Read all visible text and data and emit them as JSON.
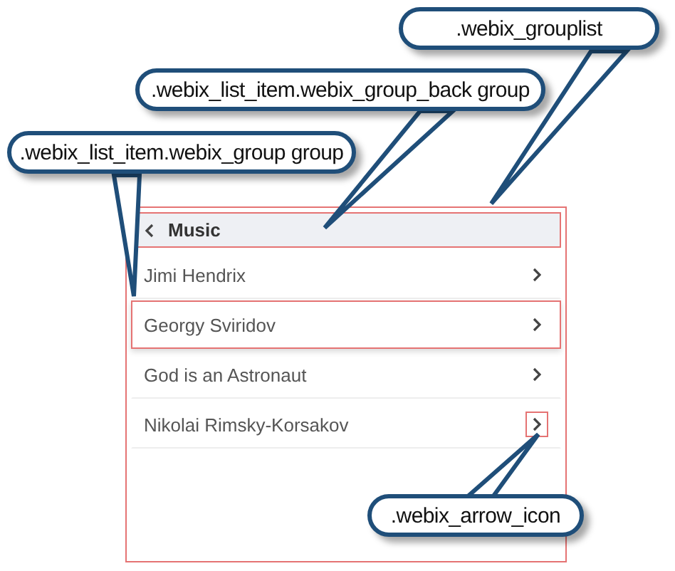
{
  "list": {
    "outlined": true,
    "back": {
      "label": "Music",
      "outlined": true
    },
    "items": [
      {
        "label": "Jimi Hendrix",
        "outlined": false,
        "arrow_outlined": false
      },
      {
        "label": "Georgy Sviridov",
        "outlined": true,
        "arrow_outlined": false
      },
      {
        "label": "God is an Astronaut",
        "outlined": false,
        "arrow_outlined": false
      },
      {
        "label": "Nikolai Rimsky-Korsakov",
        "outlined": false,
        "arrow_outlined": true
      }
    ]
  },
  "callouts": [
    {
      "text": ".webix_grouplist"
    },
    {
      "text": ".webix_list_item.webix_group_back group"
    },
    {
      "text": ".webix_list_item.webix_group group"
    },
    {
      "text": ".webix_arrow_icon"
    }
  ]
}
